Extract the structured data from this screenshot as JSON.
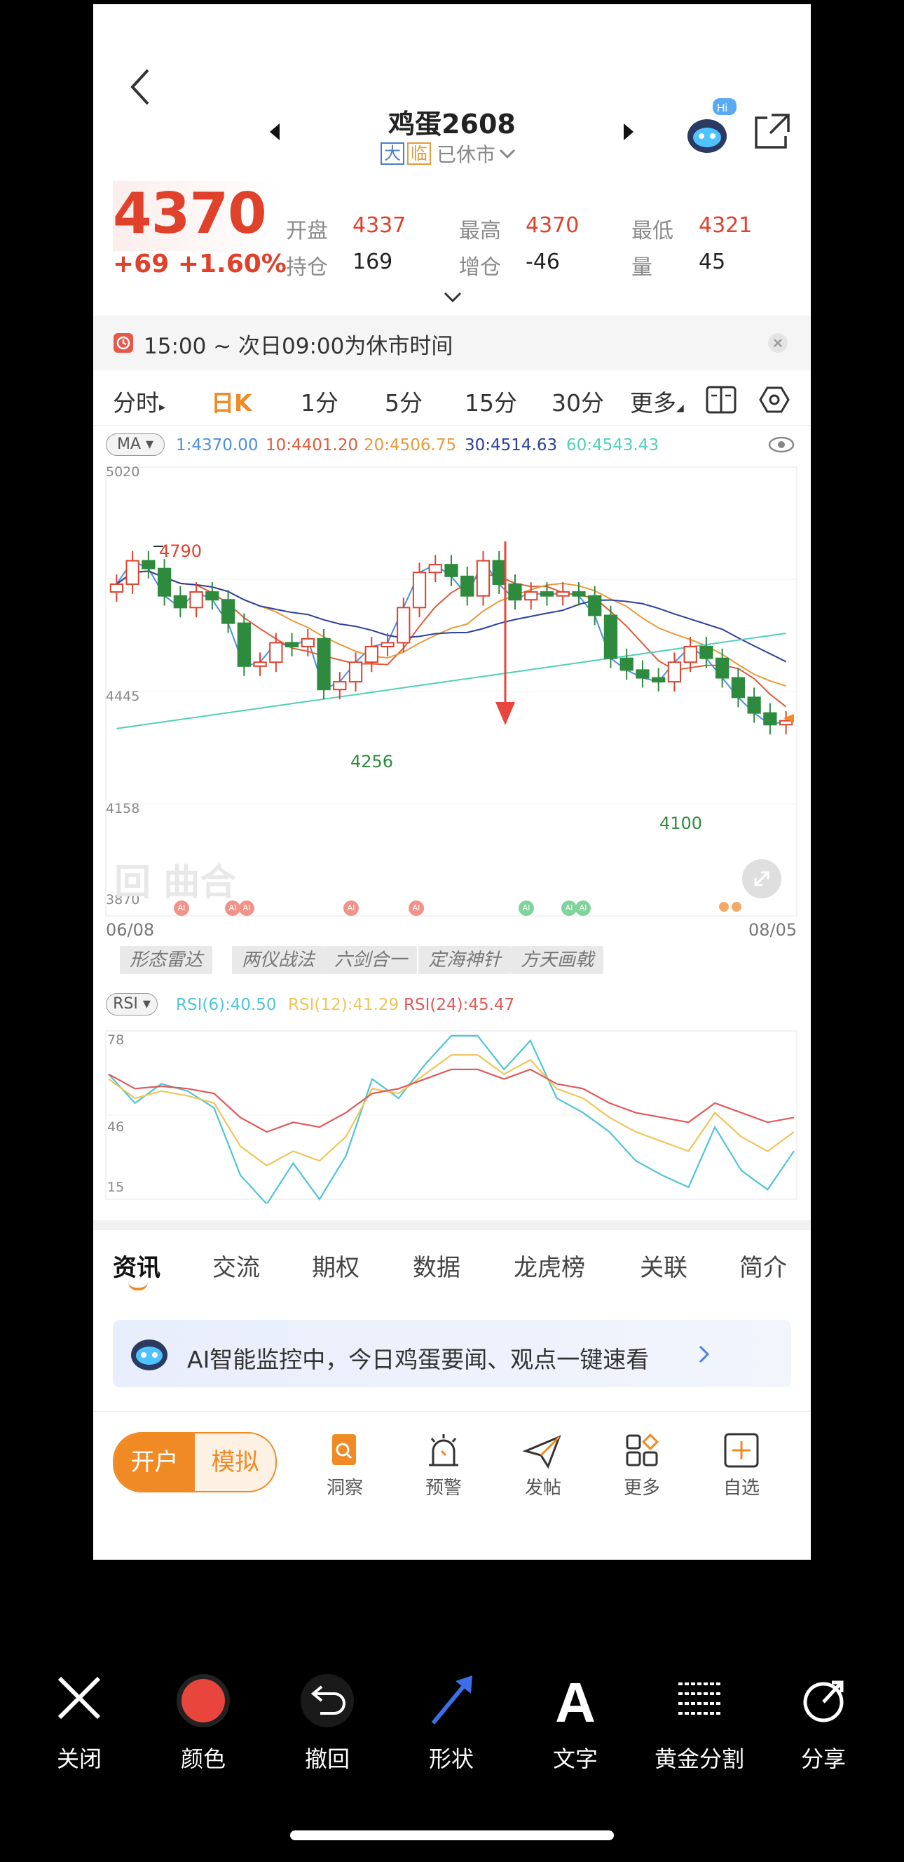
{
  "header": {
    "title": "鸡蛋2608",
    "badge_da": "大",
    "badge_lin": "临",
    "status": "已休市"
  },
  "price": {
    "last": "4370",
    "change": "+69",
    "change_pct": "+1.60%"
  },
  "stats": {
    "open_label": "开盘",
    "open": "4337",
    "high_label": "最高",
    "high": "4370",
    "low_label": "最低",
    "low": "4321",
    "oi_label": "持仓",
    "oi": "169",
    "oi_chg_label": "增仓",
    "oi_chg": "-46",
    "vol_label": "量",
    "vol": "45"
  },
  "notice": {
    "text": "15:00 ~ 次日09:00为休市时间"
  },
  "period_tabs": [
    "分时",
    "日K",
    "1分",
    "5分",
    "15分",
    "30分",
    "更多"
  ],
  "ma": {
    "selector": "MA",
    "ma1": "1:4370.00",
    "ma10": "10:4401.20",
    "ma20": "20:4506.75",
    "ma30": "30:4514.63",
    "ma60": "60:4543.43"
  },
  "colors": {
    "ma1": "#4a90e2",
    "ma10": "#e05a3a",
    "ma20": "#e89a3c",
    "ma30": "#2c3e9e",
    "ma60": "#4fd1b8",
    "up": "#e0412b",
    "down": "#2e8b3e"
  },
  "chart_ticks": {
    "y1": "5020",
    "y2": "4445",
    "y3": "4158",
    "y4": "3870",
    "x_start": "06/08",
    "x_end": "08/05"
  },
  "chart_marks": {
    "high": "4790",
    "low1": "4256",
    "low2": "4100"
  },
  "watermark": "曲合",
  "ai_badge": "AI",
  "strategy_tags": [
    "形态雷达",
    "两仪战法",
    "六剑合一",
    "定海神针",
    "方天画戟"
  ],
  "rsi": {
    "selector": "RSI",
    "rsi6": "RSI(6):40.50",
    "rsi12": "RSI(12):41.29",
    "rsi24": "RSI(24):45.47",
    "y1": "78",
    "y2": "46",
    "y3": "15"
  },
  "news_tabs": [
    "资讯",
    "交流",
    "期权",
    "数据",
    "龙虎榜",
    "关联",
    "简介"
  ],
  "ai_banner": {
    "text": "AI智能监控中，今日鸡蛋要闻、观点一键速看"
  },
  "toolbar": {
    "open_account": "开户",
    "simulate": "模拟",
    "items": [
      "洞察",
      "预警",
      "发帖",
      "更多",
      "自选"
    ]
  },
  "editor": {
    "items": [
      "关闭",
      "颜色",
      "撤回",
      "形状",
      "文字",
      "黄金分割",
      "分享"
    ],
    "color": "#e8453c"
  },
  "chart_data": {
    "type": "candlestick",
    "x_range": [
      "06/08",
      "08/05"
    ],
    "ylim": [
      3870,
      5020
    ],
    "y_ticks": [
      5020,
      4445,
      4158,
      3870
    ],
    "annotations": [
      {
        "label": "4790",
        "type": "high"
      },
      {
        "label": "4256",
        "type": "low"
      },
      {
        "label": "4100",
        "type": "low"
      }
    ],
    "close_series": [
      4720,
      4780,
      4760,
      4690,
      4660,
      4700,
      4680,
      4620,
      4510,
      4520,
      4570,
      4560,
      4580,
      4450,
      4470,
      4520,
      4560,
      4570,
      4660,
      4750,
      4770,
      4740,
      4690,
      4780,
      4720,
      4680,
      4700,
      4690,
      4700,
      4690,
      4640,
      4530,
      4500,
      4480,
      4470,
      4520,
      4560,
      4530,
      4480,
      4430,
      4390,
      4360,
      4370
    ],
    "ma_values": {
      "MA1": 4370.0,
      "MA10": 4401.2,
      "MA20": 4506.75,
      "MA30": 4514.63,
      "MA60": 4543.43
    }
  }
}
